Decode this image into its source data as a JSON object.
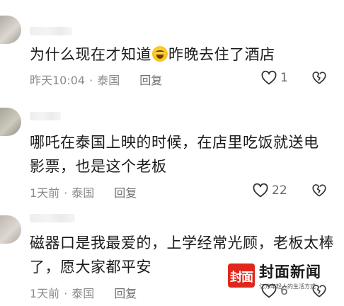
{
  "comments": [
    {
      "text_before": "为什么现在才知道",
      "emoji": "laughing-crying-emoji",
      "text_after": "昨晚去住了酒店",
      "time": "昨天10:04",
      "location": "泰国",
      "reply": "回复",
      "likes": "1"
    },
    {
      "text": "哪吒在泰国上映的时候，在店里吃饭就送电影票，也是这个老板",
      "time": "1天前",
      "location": "泰国",
      "reply": "回复",
      "likes": "22"
    },
    {
      "text": "磁器口是我最爱的，上学经常光顾，老板太棒了，愿大家都平安",
      "time": "1天前",
      "location": "泰国",
      "reply": "回复",
      "likes": "6"
    }
  ],
  "separator": "·",
  "watermark": {
    "logo": "封面",
    "title": "封面新闻",
    "subtitle": "亿万年轻人的生活方式"
  }
}
